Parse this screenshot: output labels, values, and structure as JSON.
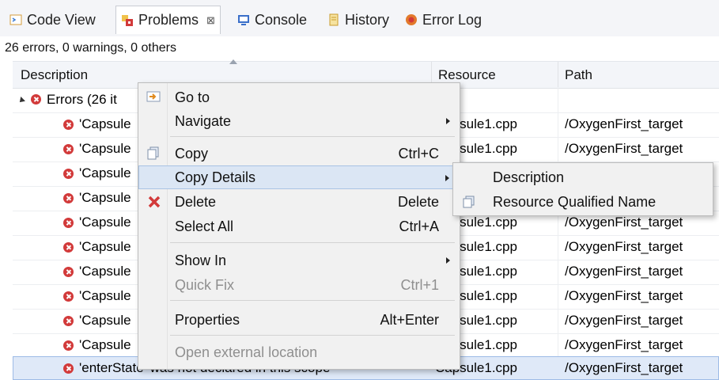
{
  "tabs": [
    {
      "label": "Code View",
      "icon": "code-view-icon"
    },
    {
      "label": "Problems",
      "icon": "problems-icon",
      "close": "⊠"
    },
    {
      "label": "Console",
      "icon": "console-icon"
    },
    {
      "label": "History",
      "icon": "history-icon"
    },
    {
      "label": "Error Log",
      "icon": "error-log-icon"
    }
  ],
  "summary": "26 errors, 0 warnings, 0 others",
  "columns": {
    "description": "Description",
    "resource": "Resource",
    "path": "Path"
  },
  "group": {
    "label": "Errors (26 it"
  },
  "rows": [
    {
      "description": "'Capsule",
      "resource": "Capsule1.cpp",
      "path": "/OxygenFirst_target"
    },
    {
      "description": "'Capsule",
      "resource": "Capsule1.cpp",
      "path": "/OxygenFirst_target"
    },
    {
      "description": "'Capsule",
      "resource": "",
      "path": ""
    },
    {
      "description": "'Capsule",
      "resource": "",
      "path": ""
    },
    {
      "description": "'Capsule",
      "resource": "Capsule1.cpp",
      "path": "/OxygenFirst_target"
    },
    {
      "description": "'Capsule",
      "resource": "Capsule1.cpp",
      "path": "/OxygenFirst_target"
    },
    {
      "description": "'Capsule",
      "resource": "Capsule1.cpp",
      "path": "/OxygenFirst_target"
    },
    {
      "description": "'Capsule",
      "resource": "Capsule1.cpp",
      "path": "/OxygenFirst_target"
    },
    {
      "description": "'Capsule",
      "resource": "Capsule1.cpp",
      "path": "/OxygenFirst_target"
    },
    {
      "description": "'Capsule",
      "resource": "Capsule1.cpp",
      "path": "/OxygenFirst_target"
    }
  ],
  "selected_row": {
    "description": "'enterState' was not declared in this scope",
    "resource": "Capsule1.cpp",
    "path": "/OxygenFirst_target"
  },
  "context_menu": {
    "goto": "Go to",
    "navigate": "Navigate",
    "copy": "Copy",
    "copy_shortcut": "Ctrl+C",
    "copy_details": "Copy Details",
    "delete": "Delete",
    "delete_shortcut": "Delete",
    "select_all": "Select All",
    "select_all_shortcut": "Ctrl+A",
    "show_in": "Show In",
    "quick_fix": "Quick Fix",
    "quick_fix_shortcut": "Ctrl+1",
    "properties": "Properties",
    "properties_shortcut": "Alt+Enter",
    "open_external": "Open external location"
  },
  "submenu": {
    "description": "Description",
    "resource_qualified_name": "Resource Qualified Name"
  },
  "colors": {
    "error": "#d23a3a",
    "highlight": "#dbe6f4",
    "selection": "#dfe9f8"
  }
}
